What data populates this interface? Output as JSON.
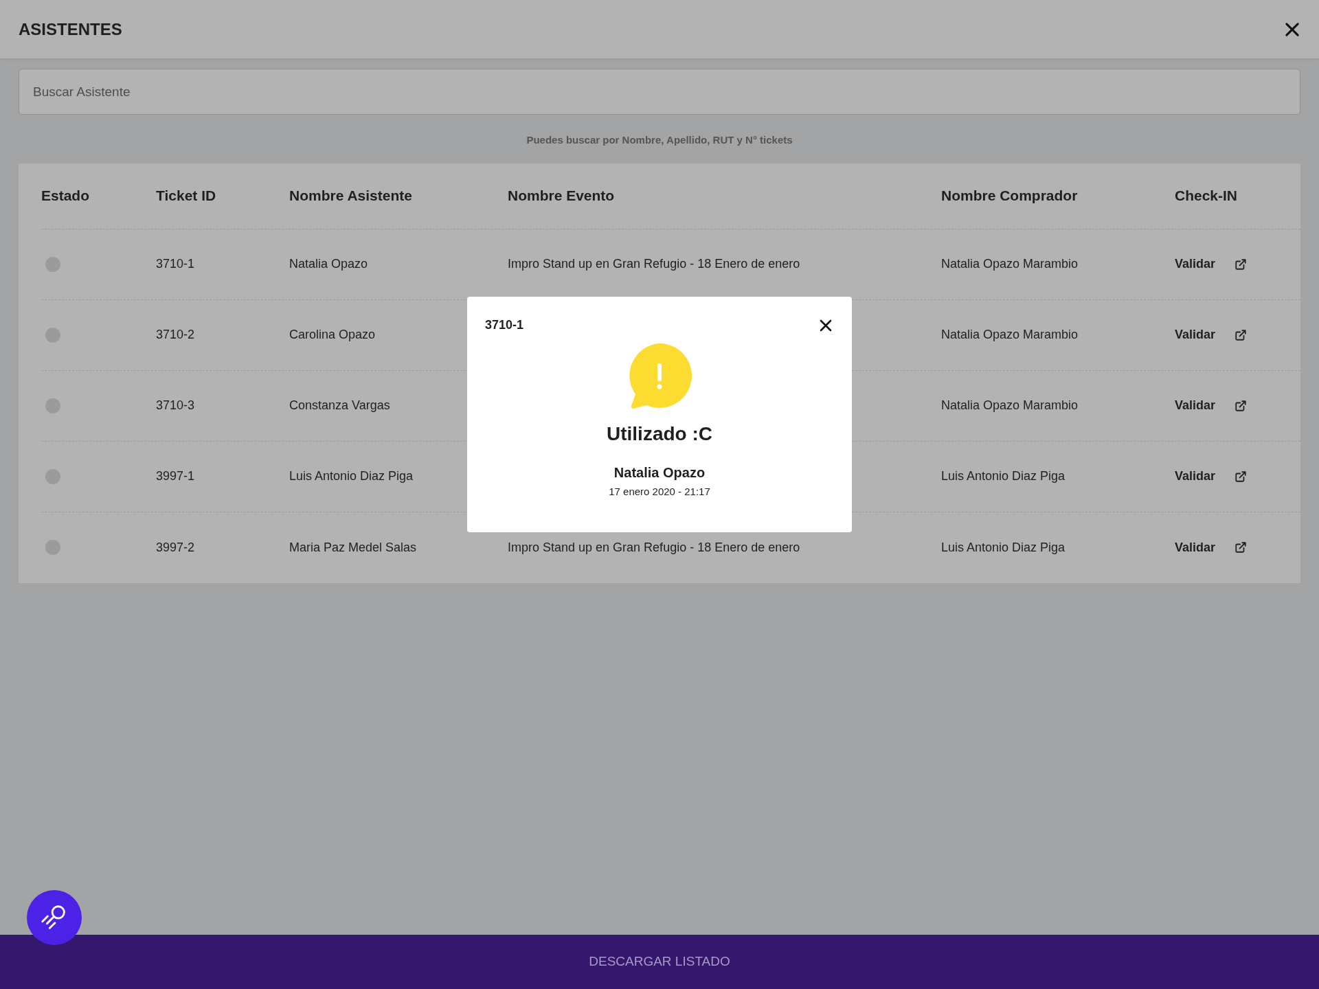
{
  "header": {
    "title": "ASISTENTES"
  },
  "search": {
    "placeholder": "Buscar Asistente",
    "hint": "Puedes buscar por Nombre, Apellido, RUT y N° tickets"
  },
  "table": {
    "columns": [
      "Estado",
      "Ticket ID",
      "Nombre Asistente",
      "Nombre Evento",
      "Nombre Comprador",
      "Check-IN"
    ],
    "rows": [
      {
        "ticket_id": "3710-1",
        "attendee": "Natalia Opazo",
        "event": "Impro Stand up en Gran Refugio - 18 Enero de enero",
        "buyer": "Natalia Opazo Marambio",
        "action": "Validar"
      },
      {
        "ticket_id": "3710-2",
        "attendee": "Carolina Opazo",
        "buyer": "Natalia Opazo Marambio",
        "action": "Validar"
      },
      {
        "ticket_id": "3710-3",
        "attendee": "Constanza Vargas",
        "buyer": "Natalia Opazo Marambio",
        "action": "Validar"
      },
      {
        "ticket_id": "3997-1",
        "attendee": "Luis Antonio Diaz Piga",
        "buyer": "Luis Antonio Diaz Piga",
        "action": "Validar"
      },
      {
        "ticket_id": "3997-2",
        "attendee": "Maria Paz Medel Salas",
        "event": "Impro Stand up en Gran Refugio - 18 Enero de enero",
        "buyer": "Luis Antonio Diaz Piga",
        "action": "Validar"
      }
    ]
  },
  "modal": {
    "title": "3710-1",
    "status": "Utilizado :C",
    "name": "Natalia Opazo",
    "date": "17 enero 2020 - 21:17"
  },
  "footer": {
    "button": "DESCARGAR LISTADO"
  }
}
